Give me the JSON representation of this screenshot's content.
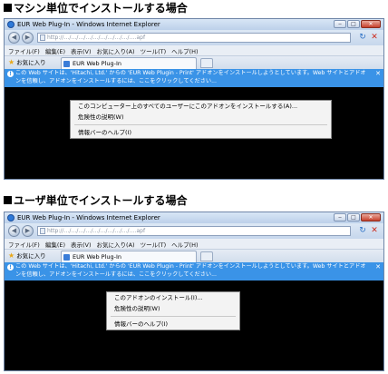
{
  "section1": {
    "heading": "マシン単位でインストールする場合"
  },
  "section2": {
    "heading": "ユーザ単位でインストールする場合"
  },
  "browser": {
    "title": "EUR Web Plug-In - Windows Internet Explorer",
    "address_url": "http://…/…/…/…/…/…/…/…/…/….apf",
    "menu": [
      "ファイル(F)",
      "編集(E)",
      "表示(V)",
      "お気に入り(A)",
      "ツール(T)",
      "ヘルプ(H)"
    ],
    "favorites_label": "お気に入り",
    "tab_label": "EUR Web Plug-In",
    "infobar_text": "この Web サイトは、'Hitachi, Ltd.' からの 'EUR Web Plugin - Print' アドオンをインストールしようとしています。Web サイトとアドオンを信頼し、アドオンをインストールするには、ここをクリックしてください...",
    "window_buttons": {
      "minimize": "‒",
      "maximize": "□",
      "close": "✕"
    }
  },
  "menu1": {
    "items": [
      "このコンピューター上のすべてのユーザーにこのアドオンをインストールする(A)...",
      "危険性の説明(W)",
      "情報バーのヘルプ(I)"
    ]
  },
  "menu2": {
    "items": [
      "このアドオンのインストール(I)...",
      "危険性の説明(W)",
      "情報バーのヘルプ(I)"
    ]
  },
  "icons": [
    "ie-icon",
    "back-icon",
    "forward-icon",
    "refresh-icon",
    "stop-icon",
    "favorites-star-icon",
    "shield-icon",
    "close-icon"
  ],
  "colors": {
    "infobar": "#3a93e7",
    "content": "#000000",
    "chrome": "#cfdcec"
  }
}
